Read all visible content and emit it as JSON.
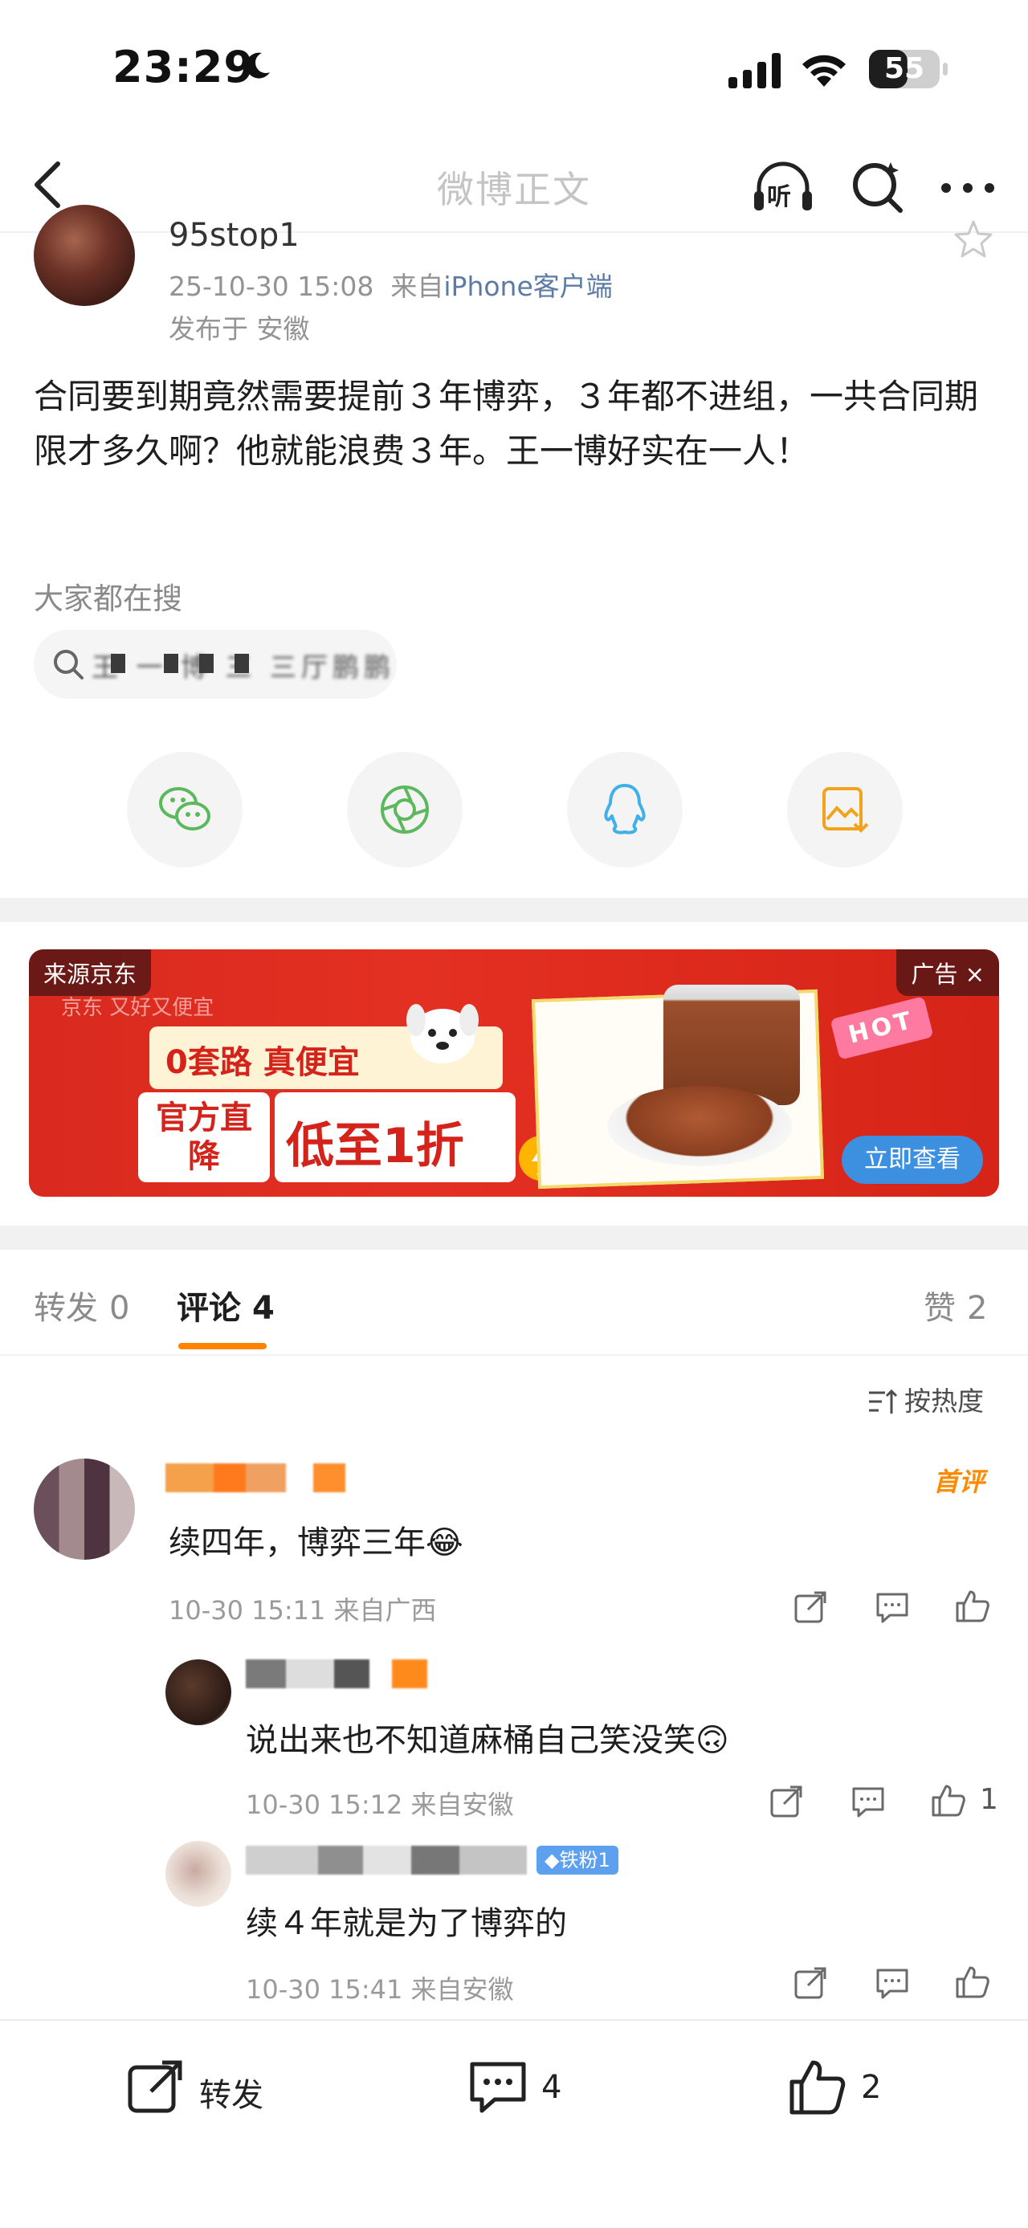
{
  "status_bar": {
    "time": "23:29",
    "battery": "55",
    "battery_level_percent": 55
  },
  "nav": {
    "title": "微博正文",
    "listen_label": "听"
  },
  "post": {
    "username": "95stop1",
    "timestamp": "25-10-30 15:08",
    "source_prefix": "来自",
    "source": "iPhone客户端",
    "location": "发布于 安徽",
    "body": "合同要到期竟然需要提前３年博弈，３年都不进组，一共合同期限才多久啊？他就能浪费３年。王一博好实在一人！"
  },
  "hot_search": {
    "title": "大家都在搜",
    "query": "王 一 博 三 三厅鹏鹏"
  },
  "share": {
    "items": [
      {
        "icon": "wechat-icon",
        "color": "#5cb85c"
      },
      {
        "icon": "moments-icon",
        "color": "#5cb85c"
      },
      {
        "icon": "qq-icon",
        "color": "#3fb0e8"
      },
      {
        "icon": "save-image-icon",
        "color": "#f2a31b"
      }
    ]
  },
  "ad": {
    "source": "来源京东",
    "tag": "广告 ×",
    "jd_line": "京东  又好又便宜",
    "headline": "0套路 真便宜",
    "deal_left": "官方直降",
    "deal_right": "低至1折",
    "hot": "HOT",
    "cta": "立即查看"
  },
  "tabs": {
    "repost": {
      "label": "转发",
      "count": "0"
    },
    "comments": {
      "label": "评论",
      "count": "4"
    },
    "likes": {
      "label": "赞",
      "count": "2"
    }
  },
  "sort": {
    "label": "按热度"
  },
  "comments": [
    {
      "text": "续四年，博弈三年😂",
      "meta": "10-30 15:11 来自广西",
      "badge": "首评",
      "likes": ""
    },
    {
      "text": "说出来也不知道麻桶自己笑没笑🙃",
      "meta": "10-30 15:12 来自安徽",
      "likes": "1"
    },
    {
      "text": "续４年就是为了博弈的",
      "meta": "10-30 15:41 来自安徽",
      "fan_badge": "◆铁粉1",
      "likes": ""
    }
  ],
  "bottom_bar": {
    "repost": "转发",
    "comment_count": "4",
    "like_count": "2"
  }
}
